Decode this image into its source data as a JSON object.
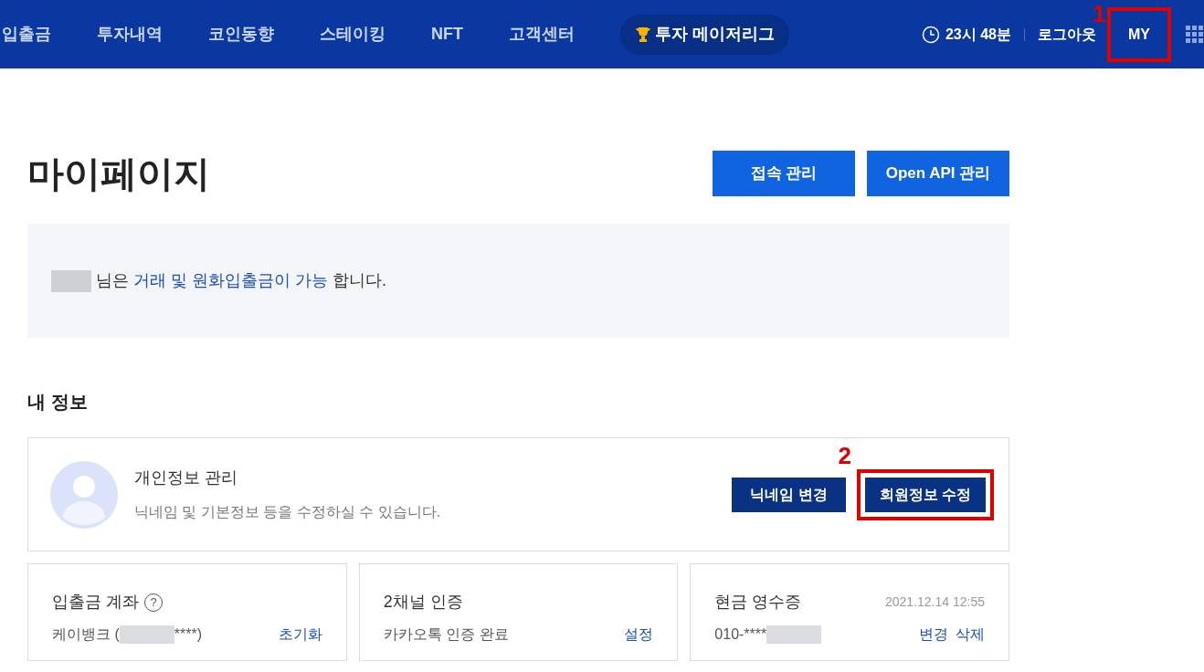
{
  "nav": {
    "items": [
      "입출금",
      "투자내역",
      "코인동향",
      "스테이킹",
      "NFT",
      "고객센터"
    ],
    "league": "투자 메이저리그",
    "time": "23시 48분",
    "logout": "로그아웃",
    "my": "MY"
  },
  "page": {
    "title": "마이페이지",
    "buttons": [
      "접속 관리",
      "Open API 관리"
    ]
  },
  "notice": {
    "suffix": "님은",
    "link": "거래 및 원화입출금이 가능",
    "end": "합니다."
  },
  "section_title": "내 정보",
  "profile": {
    "title": "개인정보 관리",
    "description": "닉네임 및 기본정보 등을 수정하실 수 있습니다.",
    "buttons": [
      "닉네임 변경",
      "회원정보 수정"
    ]
  },
  "cards": [
    {
      "kind": "account",
      "title": "입출금 계좌",
      "help": "?",
      "value_prefix": "케이뱅크 (",
      "value_suffix": "****)",
      "actions": [
        "초기화"
      ]
    },
    {
      "kind": "plain",
      "title": "2채널 인증",
      "value_prefix": "카카오톡 인증 완료",
      "actions": [
        "설정"
      ]
    },
    {
      "kind": "receipt",
      "title": "현금 영수증",
      "date": "2021.12.14 12:55",
      "value_prefix": "010-****",
      "actions": [
        "변경",
        "삭제"
      ]
    }
  ],
  "annotations": [
    "1",
    "2"
  ]
}
